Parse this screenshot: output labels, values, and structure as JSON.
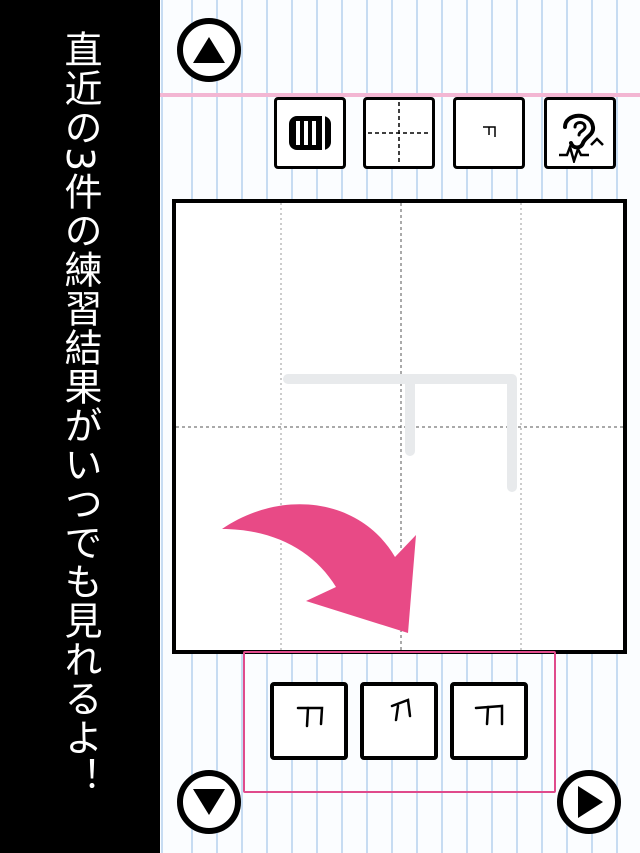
{
  "banner": {
    "text": "直近の3件の練習結果がいつでも見れるよ！"
  },
  "practice": {
    "character": "ㄱ"
  },
  "tools": [
    {
      "name": "history",
      "icon": "history-icon"
    },
    {
      "name": "grid-guide",
      "icon": "grid-icon"
    },
    {
      "name": "model-character",
      "icon": "character-preview-icon"
    },
    {
      "name": "listen",
      "icon": "ear-sound-icon"
    }
  ],
  "navigation": {
    "up_icon": "up-triangle-icon",
    "down_icon": "down-triangle-icon",
    "next_icon": "play-right-icon"
  },
  "recent_results": {
    "count": 3,
    "items": [
      "result-1",
      "result-2",
      "result-3"
    ]
  },
  "colors": {
    "accent_pink": "#e84a86",
    "banner_bg": "#000000",
    "notebook_lines": "#c7dcf2",
    "margin_line": "#f3b6d3"
  }
}
